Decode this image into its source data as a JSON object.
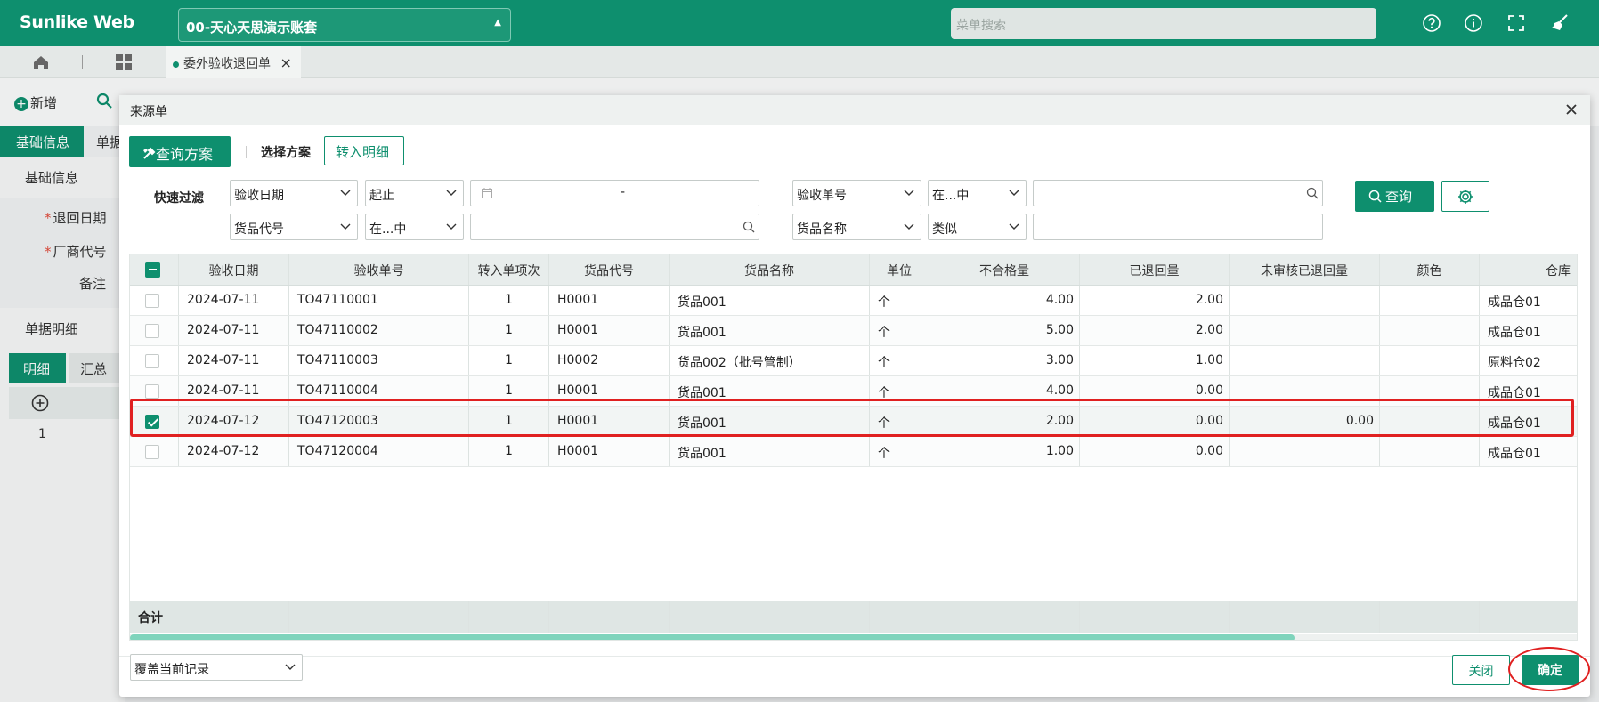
{
  "app": {
    "brand": "Sunlike Web",
    "account": "00-天心天思演示账套",
    "menu_search_placeholder": "菜单搜索",
    "top_icons": [
      "help-icon",
      "info-icon",
      "fullscreen-icon",
      "broom-icon"
    ]
  },
  "tabs": {
    "open_tab_label": "委外验收退回单",
    "close_glyph": "×"
  },
  "background_page": {
    "toolbar": {
      "new_label": "新增"
    },
    "tabs": [
      "基础信息",
      "单据"
    ],
    "section_title": "基础信息",
    "fields": [
      {
        "label": "退回日期",
        "required": true
      },
      {
        "label": "厂商代号",
        "required": true
      },
      {
        "label": "备注",
        "required": false
      }
    ],
    "detail_title": "单据明细",
    "detail_tabs": [
      "明细",
      "汇总"
    ],
    "row_number": "1"
  },
  "dialog": {
    "title": "来源单",
    "scheme_button": "查询方案",
    "select_scheme_label": "选择方案",
    "transfer_detail_button": "转入明细",
    "quick_filter_label": "快速过滤",
    "filters": {
      "row1": {
        "field1": "验收日期",
        "op1": "起止",
        "date_separator": "-",
        "field2": "验收单号",
        "op2": "在...中",
        "value2": ""
      },
      "row2": {
        "field1": "货品代号",
        "op1": "在...中",
        "value1": "",
        "field2": "货品名称",
        "op2": "类似",
        "value2": ""
      }
    },
    "query_button": "查询",
    "grid": {
      "columns": [
        "验收日期",
        "验收单号",
        "转入单项次",
        "货品代号",
        "货品名称",
        "单位",
        "不合格量",
        "已退回量",
        "未审核已退回量",
        "颜色",
        "仓库"
      ],
      "rows": [
        {
          "checked": false,
          "date": "2024-07-11",
          "no": "TO47110001",
          "seq": "1",
          "code": "H0001",
          "name": "货品001",
          "unit": "个",
          "bad_qty": "4.00",
          "returned": "2.00",
          "unapproved": "",
          "color": "",
          "warehouse": "成品仓01"
        },
        {
          "checked": false,
          "date": "2024-07-11",
          "no": "TO47110002",
          "seq": "1",
          "code": "H0001",
          "name": "货品001",
          "unit": "个",
          "bad_qty": "5.00",
          "returned": "2.00",
          "unapproved": "",
          "color": "",
          "warehouse": "成品仓01"
        },
        {
          "checked": false,
          "date": "2024-07-11",
          "no": "TO47110003",
          "seq": "1",
          "code": "H0002",
          "name": "货品002（批号管制）",
          "unit": "个",
          "bad_qty": "3.00",
          "returned": "1.00",
          "unapproved": "",
          "color": "",
          "warehouse": "原料仓02"
        },
        {
          "checked": false,
          "date": "2024-07-11",
          "no": "TO47110004",
          "seq": "1",
          "code": "H0001",
          "name": "货品001",
          "unit": "个",
          "bad_qty": "4.00",
          "returned": "0.00",
          "unapproved": "",
          "color": "",
          "warehouse": "成品仓01"
        },
        {
          "checked": true,
          "date": "2024-07-12",
          "no": "TO47120003",
          "seq": "1",
          "code": "H0001",
          "name": "货品001",
          "unit": "个",
          "bad_qty": "2.00",
          "returned": "0.00",
          "unapproved": "0.00",
          "color": "",
          "warehouse": "成品仓01"
        },
        {
          "checked": false,
          "date": "2024-07-12",
          "no": "TO47120004",
          "seq": "1",
          "code": "H0001",
          "name": "货品001",
          "unit": "个",
          "bad_qty": "1.00",
          "returned": "0.00",
          "unapproved": "",
          "color": "",
          "warehouse": "成品仓01"
        }
      ],
      "footer_label": "合计"
    },
    "footer": {
      "cover_select": "覆盖当前记录",
      "close_button": "关闭",
      "ok_button": "确定"
    }
  },
  "colors": {
    "accent": "#0e8f6e",
    "highlight": "#e02020"
  }
}
